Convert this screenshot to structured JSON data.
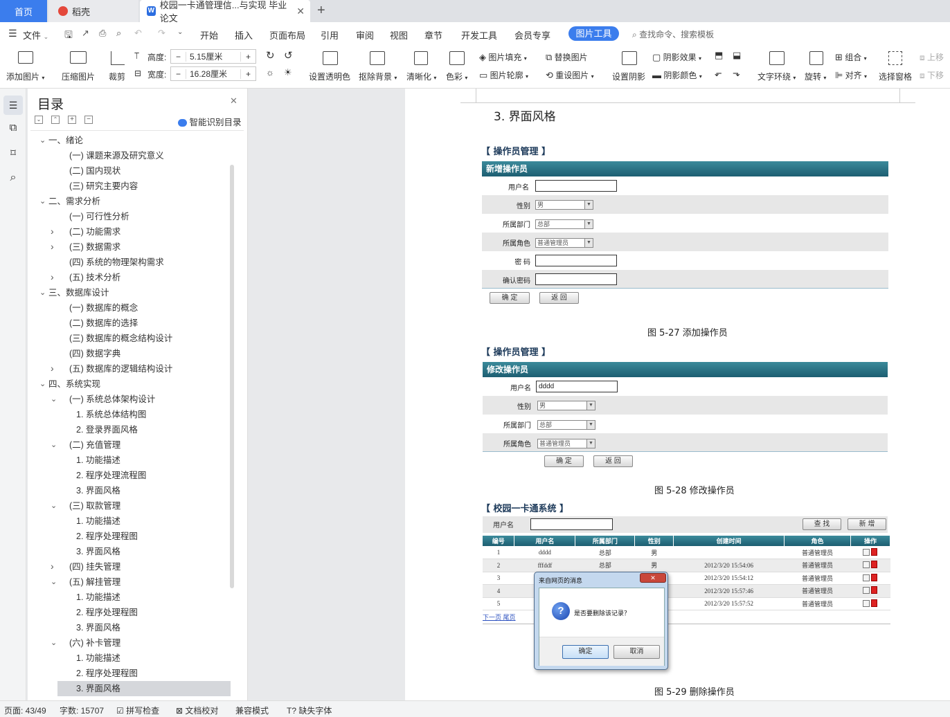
{
  "tabs": {
    "home": "首页",
    "daoke": "稻壳",
    "doc": "校园一卡通管理信...与实现 毕业论文"
  },
  "menu": {
    "file": "文件",
    "items": [
      "开始",
      "插入",
      "页面布局",
      "引用",
      "审阅",
      "视图",
      "章节",
      "开发工具",
      "会员专享"
    ],
    "active": "图片工具",
    "search": "查找命令、搜索模板"
  },
  "ribbon": {
    "add_pic": "添加图片",
    "compress": "压缩图片",
    "crop": "裁剪",
    "height_label": "高度:",
    "height_value": "5.15厘米",
    "width_label": "宽度:",
    "width_value": "16.28厘米",
    "transparent": "设置透明色",
    "remove_bg": "抠除背景",
    "sharpen": "清晰化",
    "color": "色彩",
    "pic_fill": "图片填充",
    "pic_outline": "图片轮廓",
    "replace": "替换图片",
    "reset": "重设图片",
    "shadow_set": "设置阴影",
    "shadow_effect": "阴影效果",
    "shadow_color": "阴影颜色",
    "wrap": "文字环绕",
    "rotate": "旋转",
    "group": "组合",
    "align": "对齐",
    "select_pane": "选择窗格",
    "up": "上移",
    "down": "下移"
  },
  "toc": {
    "title": "目录",
    "smart": "智能识别目录"
  },
  "toc_items": [
    {
      "l": 0,
      "a": "down",
      "t": "一、绪论"
    },
    {
      "l": 1,
      "a": "",
      "t": "(一) 课题来源及研究意义"
    },
    {
      "l": 1,
      "a": "",
      "t": "(二) 国内现状"
    },
    {
      "l": 1,
      "a": "",
      "t": "(三) 研究主要内容"
    },
    {
      "l": 0,
      "a": "down",
      "t": "二、需求分析"
    },
    {
      "l": 1,
      "a": "",
      "t": "(一) 可行性分析"
    },
    {
      "l": 1,
      "a": "right",
      "t": "(二) 功能需求"
    },
    {
      "l": 1,
      "a": "right",
      "t": "(三) 数据需求"
    },
    {
      "l": 1,
      "a": "",
      "t": "(四) 系统的物理架构需求"
    },
    {
      "l": 1,
      "a": "right",
      "t": "(五) 技术分析"
    },
    {
      "l": 0,
      "a": "down",
      "t": "三、数据库设计"
    },
    {
      "l": 1,
      "a": "",
      "t": "(一) 数据库的概念"
    },
    {
      "l": 1,
      "a": "",
      "t": "(二) 数据库的选择"
    },
    {
      "l": 1,
      "a": "",
      "t": "(三) 数据库的概念结构设计"
    },
    {
      "l": 1,
      "a": "",
      "t": "(四) 数据字典"
    },
    {
      "l": 1,
      "a": "right",
      "t": "(五) 数据库的逻辑结构设计"
    },
    {
      "l": 0,
      "a": "down",
      "t": "四、系统实现"
    },
    {
      "l": 1,
      "a": "down",
      "t": "(一) 系统总体架构设计"
    },
    {
      "l": 2,
      "a": "",
      "t": "1. 系统总体结构图"
    },
    {
      "l": 2,
      "a": "",
      "t": "2. 登录界面风格"
    },
    {
      "l": 1,
      "a": "down",
      "t": "(二) 充值管理"
    },
    {
      "l": 2,
      "a": "",
      "t": "1. 功能描述"
    },
    {
      "l": 2,
      "a": "",
      "t": "2. 程序处理流程图"
    },
    {
      "l": 2,
      "a": "",
      "t": "3. 界面风格"
    },
    {
      "l": 1,
      "a": "down",
      "t": "(三) 取款管理"
    },
    {
      "l": 2,
      "a": "",
      "t": "1. 功能描述"
    },
    {
      "l": 2,
      "a": "",
      "t": "2. 程序处理程图"
    },
    {
      "l": 2,
      "a": "",
      "t": "3. 界面风格"
    },
    {
      "l": 1,
      "a": "right",
      "t": "(四) 挂失管理"
    },
    {
      "l": 1,
      "a": "down",
      "t": "(五) 解挂管理"
    },
    {
      "l": 2,
      "a": "",
      "t": "1. 功能描述"
    },
    {
      "l": 2,
      "a": "",
      "t": "2. 程序处理程图"
    },
    {
      "l": 2,
      "a": "",
      "t": "3. 界面风格"
    },
    {
      "l": 1,
      "a": "down",
      "t": "(六) 补卡管理"
    },
    {
      "l": 2,
      "a": "",
      "t": "1. 功能描述"
    },
    {
      "l": 2,
      "a": "",
      "t": "2. 程序处理程图"
    },
    {
      "l": 2,
      "a": "",
      "t": "3. 界面风格",
      "sel": true
    }
  ],
  "doc": {
    "heading": "3. 界面风格",
    "sec1": "【 操作员管理 】",
    "hdr1": "新增操作员",
    "f_user": "用户名",
    "f_sex": "性别",
    "f_dept": "所属部门",
    "f_role": "所属角色",
    "f_pwd": "密 码",
    "f_pwd2": "确认密码",
    "v_sex": "男",
    "v_dept": "总部",
    "v_role": "普通管理员",
    "v_user2": "dddd",
    "btn_ok": "确 定",
    "btn_back": "返 回",
    "cap1": "图 5-27 添加操作员",
    "sec2": "【 操作员管理 】",
    "hdr2": "修改操作员",
    "cap2": "图 5-28 修改操作员",
    "sec3": "【 校园一卡通系统 】",
    "search_label": "用户名",
    "btn_search": "查 找",
    "btn_new": "新 增",
    "cols": [
      "编号",
      "用户名",
      "所属部门",
      "性别",
      "创建时间",
      "角色",
      "操作"
    ],
    "pager": "下一页 尾页",
    "cap3": "图 5-29 删除操作员"
  },
  "rows": [
    {
      "id": "1",
      "u": "dddd",
      "d": "总部",
      "s": "男",
      "t": "",
      "r": "普通管理员"
    },
    {
      "id": "2",
      "u": "fffddf",
      "d": "总部",
      "s": "男",
      "t": "2012/3/20 15:54:06",
      "r": "普通管理员"
    },
    {
      "id": "3",
      "u": "",
      "d": "",
      "s": "",
      "t": "2012/3/20 15:54:12",
      "r": "普通管理员"
    },
    {
      "id": "4",
      "u": "",
      "d": "",
      "s": "",
      "t": "2012/3/20 15:57:46",
      "r": "普通管理员"
    },
    {
      "id": "5",
      "u": "",
      "d": "",
      "s": "",
      "t": "2012/3/20 15:57:52",
      "r": "普通管理员"
    }
  ],
  "dialog": {
    "title": "来自网页的消息",
    "msg": "是否要删除该记录？",
    "ok": "确定",
    "cancel": "取消"
  },
  "status": {
    "page": "页面: 43/49",
    "words": "字数: 15707",
    "spell": "拼写检查",
    "proof": "文档校对",
    "compat": "兼容模式",
    "font": "缺失字体"
  }
}
